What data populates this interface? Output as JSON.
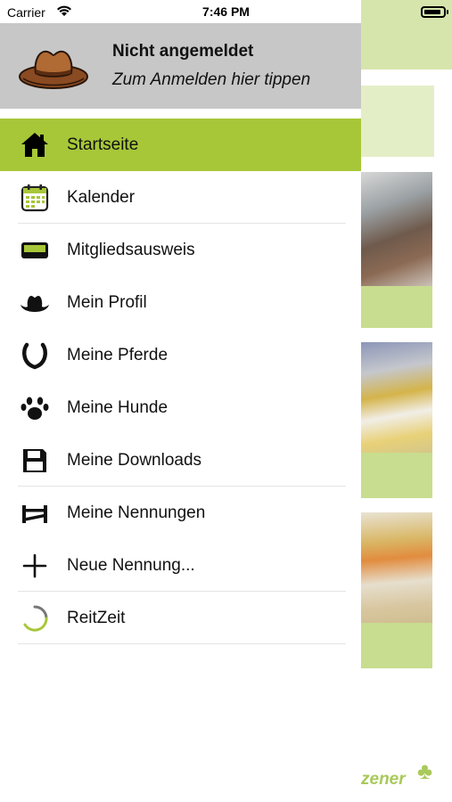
{
  "status_bar": {
    "carrier": "Carrier",
    "time": "7:46 PM"
  },
  "account": {
    "title": "Nicht angemeldet",
    "subtitle": "Zum Anmelden hier tippen"
  },
  "menu": [
    {
      "label": "Startseite",
      "icon": "home-icon",
      "active": true
    },
    {
      "label": "Kalender",
      "icon": "calendar-icon"
    },
    {
      "label": "Mitgliedsausweis",
      "icon": "membership-card-icon"
    },
    {
      "label": "Mein Profil",
      "icon": "cowboy-hat-icon"
    },
    {
      "label": "Meine Pferde",
      "icon": "horseshoe-icon"
    },
    {
      "label": "Meine Hunde",
      "icon": "paw-icon"
    },
    {
      "label": "Meine Downloads",
      "icon": "floppy-disk-icon"
    },
    {
      "label": "Meine Nennungen",
      "icon": "fence-icon"
    },
    {
      "label": "Neue Nennung...",
      "icon": "plus-icon"
    },
    {
      "label": "ReitZeit",
      "icon": "spinner-icon"
    }
  ],
  "background": {
    "logo_text": "zener"
  },
  "colors": {
    "accent": "#a7c739",
    "account_bg": "#c7c7c7",
    "bg_green": "#c8dd8f"
  }
}
